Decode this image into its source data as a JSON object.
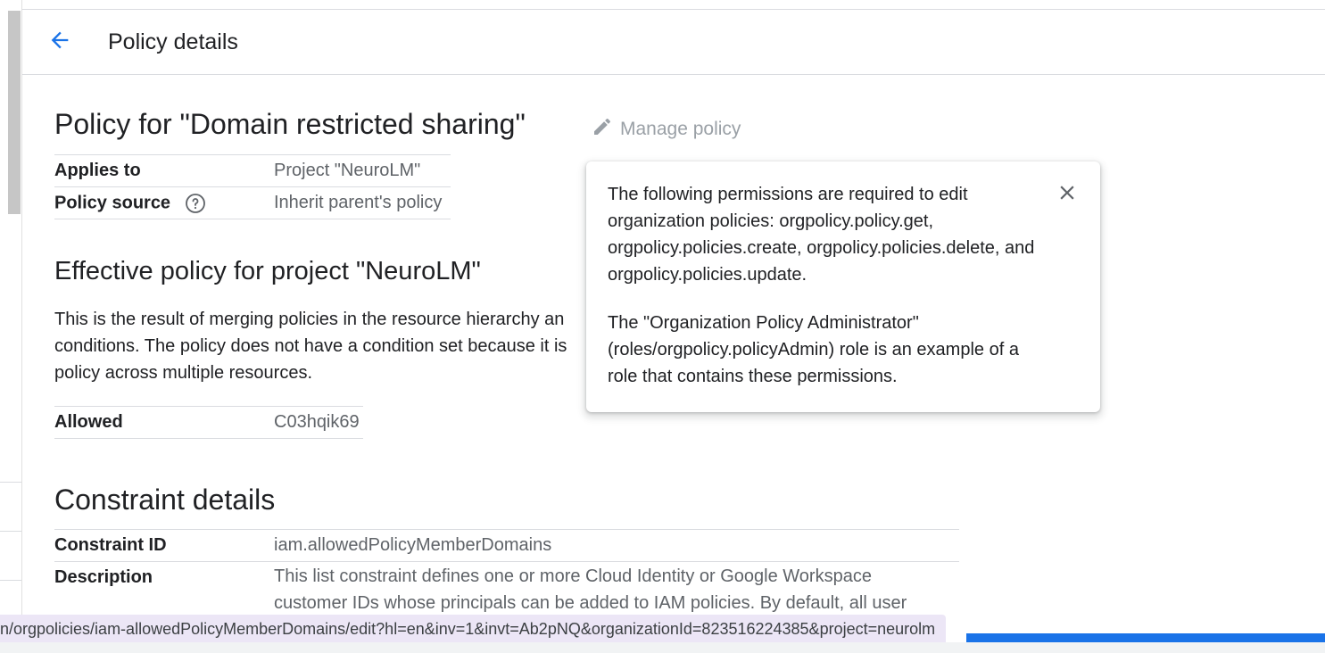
{
  "header": {
    "title": "Policy details"
  },
  "policy": {
    "title": "Policy for \"Domain restricted sharing\"",
    "manage_label": "Manage policy",
    "rows": [
      {
        "key": "Applies to",
        "value": "Project \"NeuroLM\""
      },
      {
        "key": "Policy source",
        "value": "Inherit parent's policy"
      }
    ]
  },
  "effective": {
    "title": "Effective policy for project \"NeuroLM\"",
    "lines": [
      "This is the result of merging policies in the resource hierarchy an",
      "conditions. The policy does not have a condition set because it is",
      "policy across multiple resources."
    ],
    "rows": [
      {
        "key": "Allowed",
        "value": "C03hqik69"
      }
    ]
  },
  "constraint": {
    "title": "Constraint details",
    "rows": [
      {
        "key": "Constraint ID",
        "value": "iam.allowedPolicyMemberDomains"
      },
      {
        "key": "Description",
        "value_lines": [
          "This list constraint defines one or more Cloud Identity or Google Workspace",
          "customer IDs whose principals can be added to IAM policies. By default, all user"
        ]
      }
    ]
  },
  "popover": {
    "para1": "The following permissions are required to edit organization policies: orgpolicy.policy.get, orgpolicy.policies.create, orgpolicy.policies.delete, and orgpolicy.policies.update.",
    "para2": "The \"Organization Policy Administrator\" (roles/orgpolicy.policyAdmin) role is an example of a role that contains these permissions."
  },
  "status_url": "n/orgpolicies/iam-allowedPolicyMemberDomains/edit?hl=en&inv=1&invt=Ab2pNQ&organizationId=823516224385&project=neurolm",
  "colors": {
    "accent": "#1a73e8",
    "muted": "#9aa0a6",
    "status_bg": "#ece6f6"
  },
  "icons": [
    "arrow-back-icon",
    "pencil-icon",
    "help-circle-icon",
    "close-icon"
  ]
}
